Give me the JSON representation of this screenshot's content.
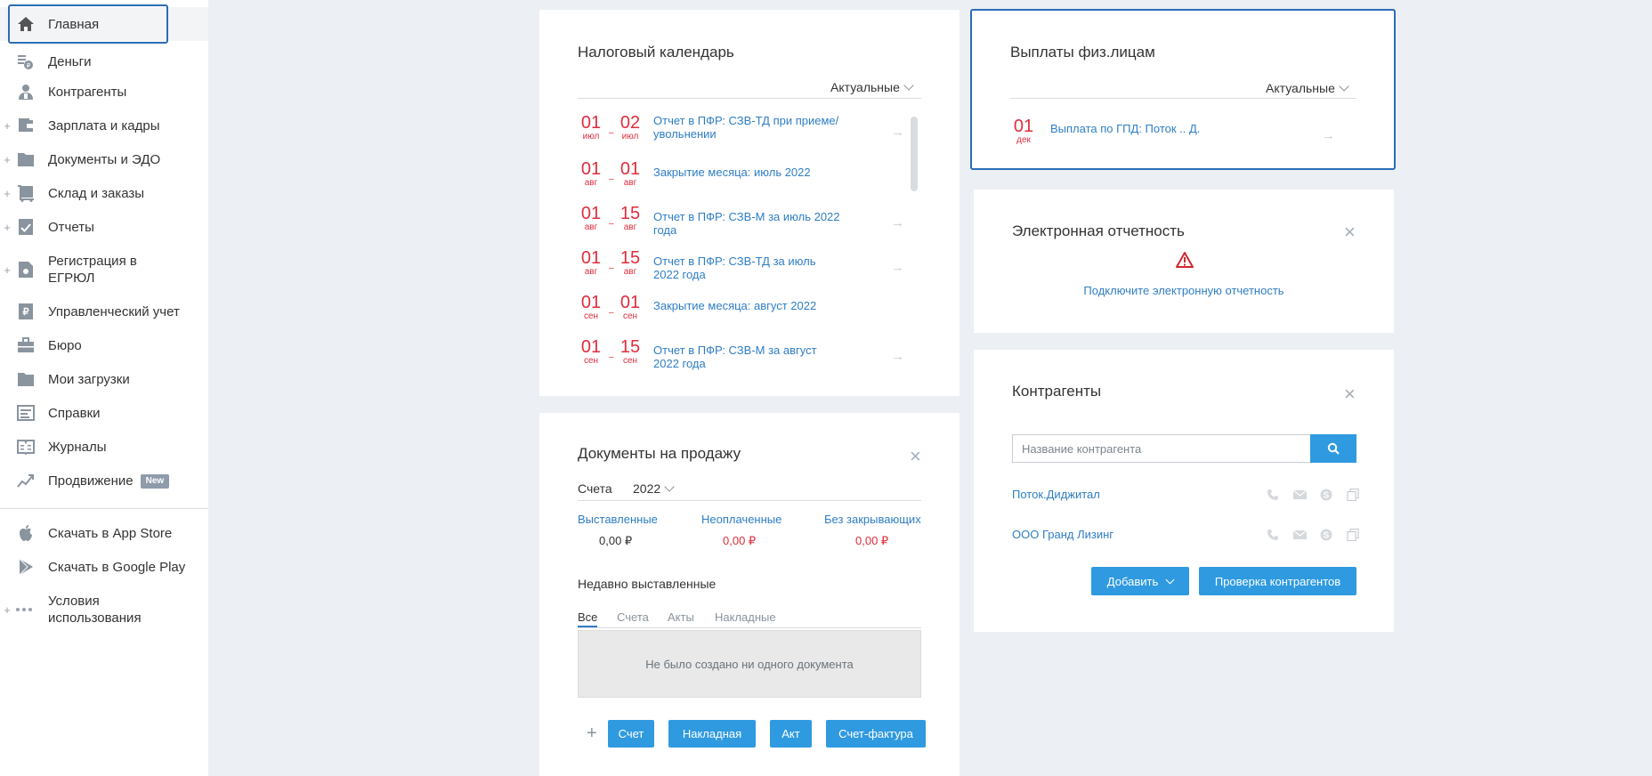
{
  "sidebar": {
    "items": [
      {
        "label": "Главная",
        "icon": "home-icon"
      },
      {
        "label": "Деньги",
        "icon": "money-icon"
      },
      {
        "label": "Контрагенты",
        "icon": "contractors-icon"
      },
      {
        "label": "Зарплата и кадры",
        "icon": "salary-icon"
      },
      {
        "label": "Документы и ЭДО",
        "icon": "folder-icon"
      },
      {
        "label": "Склад и заказы",
        "icon": "warehouse-icon"
      },
      {
        "label": "Отчеты",
        "icon": "reports-icon"
      },
      {
        "label": "Регистрация в",
        "label2": "ЕГРЮЛ",
        "icon": "registration-icon"
      },
      {
        "label": "Управленческий учет",
        "icon": "management-icon"
      },
      {
        "label": "Бюро",
        "icon": "briefcase-icon"
      },
      {
        "label": "Мои загрузки",
        "icon": "folder-icon"
      },
      {
        "label": "Справки",
        "icon": "references-icon"
      },
      {
        "label": "Журналы",
        "icon": "journals-icon"
      },
      {
        "label": "Продвижение",
        "badge": "New",
        "icon": "promotion-icon"
      },
      {
        "label": "Скачать в App Store",
        "icon": "apple-icon"
      },
      {
        "label": "Скачать в Google Play",
        "icon": "google-play-icon"
      },
      {
        "label": "Условия",
        "label2": "использования",
        "icon": "more-icon"
      }
    ]
  },
  "tax_calendar": {
    "title": "Налоговый календарь",
    "filter": "Актуальные",
    "events": [
      {
        "d1": "01",
        "m1": "июл",
        "d2": "02",
        "m2": "июл",
        "text": "Отчет в ПФР: СЗВ-ТД при приеме/увольнении"
      },
      {
        "d1": "01",
        "m1": "авг",
        "d2": "01",
        "m2": "авг",
        "text": "Закрытие месяца: июль 2022"
      },
      {
        "d1": "01",
        "m1": "авг",
        "d2": "15",
        "m2": "авг",
        "text": "Отчет в ПФР: СЗВ-М за июль 2022 года"
      },
      {
        "d1": "01",
        "m1": "авг",
        "d2": "15",
        "m2": "авг",
        "text": "Отчет в ПФР: СЗВ-ТД за июль 2022 года"
      },
      {
        "d1": "01",
        "m1": "сен",
        "d2": "01",
        "m2": "сен",
        "text": "Закрытие месяца: август 2022"
      },
      {
        "d1": "01",
        "m1": "сен",
        "d2": "15",
        "m2": "сен",
        "text": "Отчет в ПФР: СЗВ-М за август 2022 года"
      }
    ]
  },
  "payments": {
    "title": "Выплаты физ.лицам",
    "filter": "Актуальные",
    "item": {
      "day": "01",
      "month": "дек",
      "text": "Выплата по ГПД: Поток .. Д."
    }
  },
  "e_reporting": {
    "title": "Электронная отчетность",
    "link": "Подключите электронную отчетность"
  },
  "sales_docs": {
    "title": "Документы на продажу",
    "type_label": "Счета",
    "year": "2022",
    "stats": [
      {
        "label": "Выставленные",
        "value": "0,00 ₽"
      },
      {
        "label": "Неоплаченные",
        "value": "0,00 ₽"
      },
      {
        "label": "Без закрывающих",
        "value": "0,00 ₽"
      }
    ],
    "recent_title": "Недавно выставленные",
    "tabs": [
      "Все",
      "Счета",
      "Акты",
      "Накладные"
    ],
    "empty": "Не было создано ни одного документа",
    "buttons": {
      "plus": "+",
      "invoice": "Счет",
      "waybill": "Накладная",
      "act": "Акт",
      "factura": "Счет-фактура"
    }
  },
  "counterparties": {
    "title": "Контрагенты",
    "search_placeholder": "Название контрагента",
    "items": [
      "Поток.Диджитал",
      "ООО Гранд Лизинг"
    ],
    "add_button": "Добавить",
    "check_button": "Проверка контрагентов"
  },
  "colors": {
    "accent": "#2f9ae0",
    "link": "#2f7ec5",
    "date_red": "#e02d3c",
    "focus": "#2b6cb8"
  }
}
